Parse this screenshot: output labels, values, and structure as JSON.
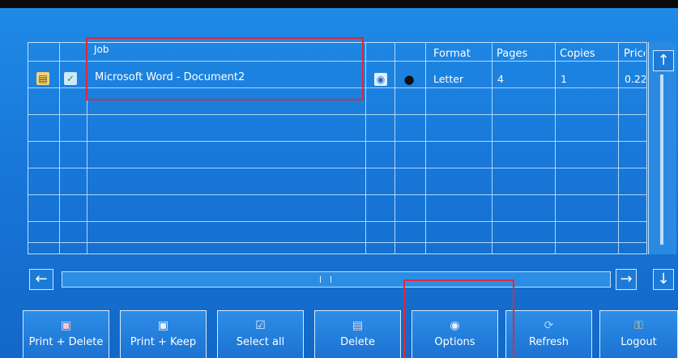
{
  "table": {
    "headers": {
      "job": "Job",
      "format": "Format",
      "pages": "Pages",
      "copies": "Copies",
      "price": "Price"
    },
    "rows": [
      {
        "job": "Microsoft Word - Document2",
        "format": "Letter",
        "pages": "4",
        "copies": "1",
        "price": "0.22"
      }
    ]
  },
  "buttons": {
    "print_delete": "Print + Delete",
    "print_keep": "Print + Keep",
    "select_all": "Select all",
    "delete": "Delete",
    "options": "Options",
    "refresh": "Refresh",
    "logout": "Logout"
  },
  "icons": {
    "scroll_left": "arrow-left-icon",
    "scroll_right": "arrow-right-icon",
    "scroll_up": "arrow-up-icon",
    "scroll_down": "arrow-down-icon"
  },
  "colors": {
    "background": "#1877d8",
    "gridline": "#bfe0ff",
    "highlight": "#e0283a"
  }
}
